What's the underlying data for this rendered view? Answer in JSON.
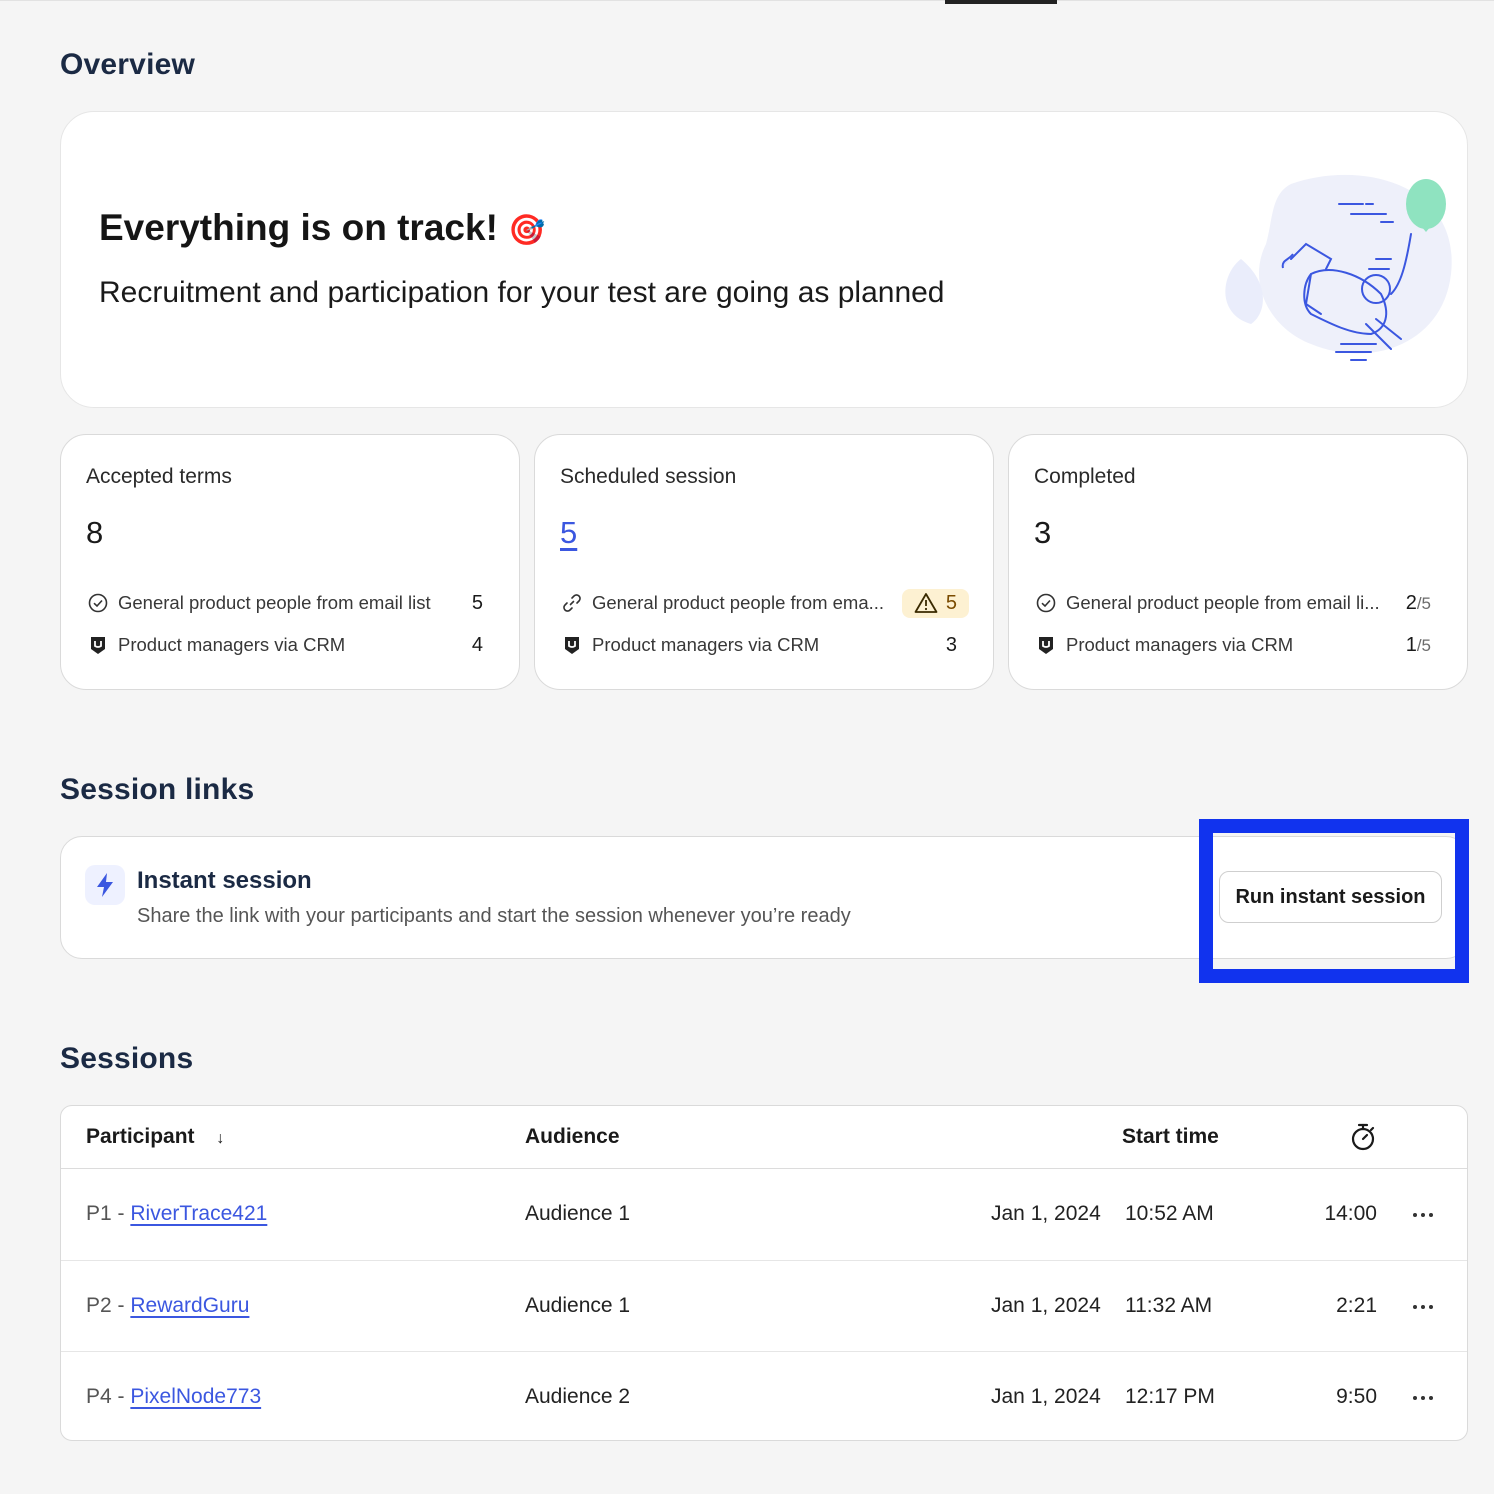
{
  "overview": {
    "heading": "Overview",
    "hero_title": "Everything is on track!",
    "hero_emoji": "🎯",
    "hero_subtitle": "Recruitment and participation for your test are going as planned"
  },
  "stats": [
    {
      "label": "Accepted terms",
      "value": "8",
      "rows": [
        {
          "icon": "check-circle-icon",
          "text": "General product people from email list",
          "count": "5"
        },
        {
          "icon": "crm-logo-icon",
          "text": "Product managers via CRM",
          "count": "4"
        }
      ]
    },
    {
      "label": "Scheduled session",
      "value": "5",
      "rows": [
        {
          "icon": "link-icon",
          "text": "General product people from ema...",
          "count": "5",
          "warning": true
        },
        {
          "icon": "crm-logo-icon",
          "text": "Product managers via CRM",
          "count": "3"
        }
      ]
    },
    {
      "label": "Completed",
      "value": "3",
      "rows": [
        {
          "icon": "check-circle-icon",
          "text": "General product people from email li...",
          "count": "2",
          "total": "/5"
        },
        {
          "icon": "crm-logo-icon",
          "text": "Product managers via CRM",
          "count": "1",
          "total": "/5"
        }
      ]
    }
  ],
  "session_links": {
    "heading": "Session links",
    "title": "Instant session",
    "description": "Share the link with your participants and start the session whenever you’re ready",
    "button": "Run instant session"
  },
  "sessions": {
    "heading": "Sessions",
    "columns": {
      "participant": "Participant",
      "audience": "Audience",
      "start_time": "Start time",
      "duration_icon": "stopwatch-icon"
    },
    "rows": [
      {
        "id": "P1 - ",
        "name": "RiverTrace421",
        "audience": "Audience 1",
        "date": "Jan 1, 2024",
        "time": "10:52 AM",
        "duration": "14:00"
      },
      {
        "id": "P2 - ",
        "name": "RewardGuru",
        "audience": "Audience 1",
        "date": "Jan 1, 2024",
        "time": "11:32 AM",
        "duration": "2:21"
      },
      {
        "id": "P4 - ",
        "name": "PixelNode773",
        "audience": "Audience 2",
        "date": "Jan 1, 2024",
        "time": "12:17 PM",
        "duration": "9:50"
      }
    ]
  },
  "colors": {
    "accent": "#3b57e0",
    "heading": "#1b2a44",
    "warning_bg": "#fdf1d2",
    "highlight": "#1133ee"
  }
}
